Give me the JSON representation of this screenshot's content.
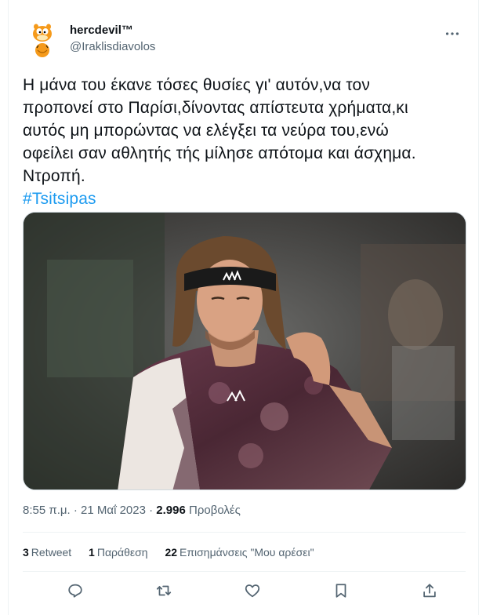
{
  "user": {
    "display_name": "hercdevil™",
    "handle": "@Iraklisdiavolos",
    "avatar_icon": "garfield-avatar"
  },
  "tweet": {
    "lines": [
      "Η μάνα του έκανε τόσες θυσίες γι' αυτόν,να τον",
      "προπονεί στο Παρίσι,δίνοντας απίστευτα χρήματα,κι",
      "αυτός μη μπορώντας να ελέγξει τα νεύρα του,ενώ",
      "οφείλει σαν αθλητής τής μίλησε απότομα και άσχημα.",
      "Ντροπή."
    ],
    "hashtag": "#Tsitsipas"
  },
  "meta": {
    "time": "8:55 π.μ.",
    "separator": "·",
    "date": "21 Μαΐ 2023",
    "views_count": "2.996",
    "views_label": "Προβολές"
  },
  "stats": {
    "retweets_count": "3",
    "retweets_label": "Retweet",
    "quotes_count": "1",
    "quotes_label": "Παράθεση",
    "likes_count": "22",
    "likes_label": "Επισημάνσεις \"Μου αρέσει\""
  },
  "colors": {
    "text": "#0f1419",
    "secondary": "#536471",
    "link": "#1d9bf0",
    "divider": "#eff3f4"
  },
  "actions": [
    "reply-icon",
    "retweet-icon",
    "like-icon",
    "bookmark-icon",
    "share-icon"
  ]
}
